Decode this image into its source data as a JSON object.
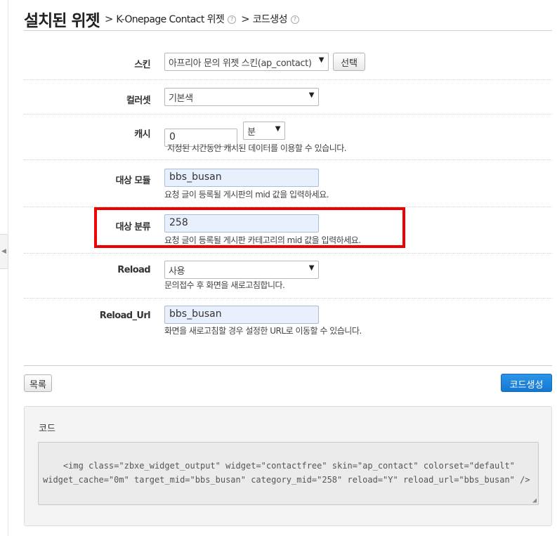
{
  "header": {
    "title": "설치된 위젯",
    "sep1": ">",
    "crumb1": "K-Onepage Contact 위젯",
    "sep2": ">",
    "crumb2": "코드생성",
    "help_glyph": "?"
  },
  "form": {
    "skin": {
      "label": "스킨",
      "value": "아프리아 문의 위젯 스킨(ap_contact)",
      "button": "선택"
    },
    "colorset": {
      "label": "컬러셋",
      "value": "기본색"
    },
    "cache": {
      "label": "캐시",
      "value": "0",
      "unit": "분",
      "desc": "지정된 시간동안 캐시된 데이터를 이용할 수 있습니다."
    },
    "target_module": {
      "label": "대상 모듈",
      "value": "bbs_busan",
      "desc": "요청 글이 등록될 게시판의 mid 값을 입력하세요."
    },
    "target_category": {
      "label": "대상 분류",
      "value": "258",
      "desc": "요청 글이 등록될 게시판 카테고리의 mid 값을 입력하세요."
    },
    "reload": {
      "label": "Reload",
      "value": "사용",
      "desc": "문의접수 후 화면을 새로고침합니다."
    },
    "reload_url": {
      "label": "Reload_Url",
      "value": "bbs_busan",
      "desc": "화면을 새로고침할 경우 설정한 URL로 이동할 수 있습니다."
    }
  },
  "footer": {
    "list_button": "목록",
    "generate_button": "코드생성"
  },
  "code": {
    "label": "코드",
    "content": "<img class=\"zbxe_widget_output\" widget=\"contactfree\" skin=\"ap_contact\" colorset=\"default\" widget_cache=\"0m\" target_mid=\"bbs_busan\" category_mid=\"258\" reload=\"Y\" reload_url=\"bbs_busan\" />"
  },
  "icons": {
    "dropdown_arrow": "▼",
    "side_toggle": "◀",
    "resize": "◢"
  },
  "colors": {
    "primary_button": "#1577d1",
    "highlight_border": "#ee0000",
    "autofill_input": "#e8f0fe"
  }
}
